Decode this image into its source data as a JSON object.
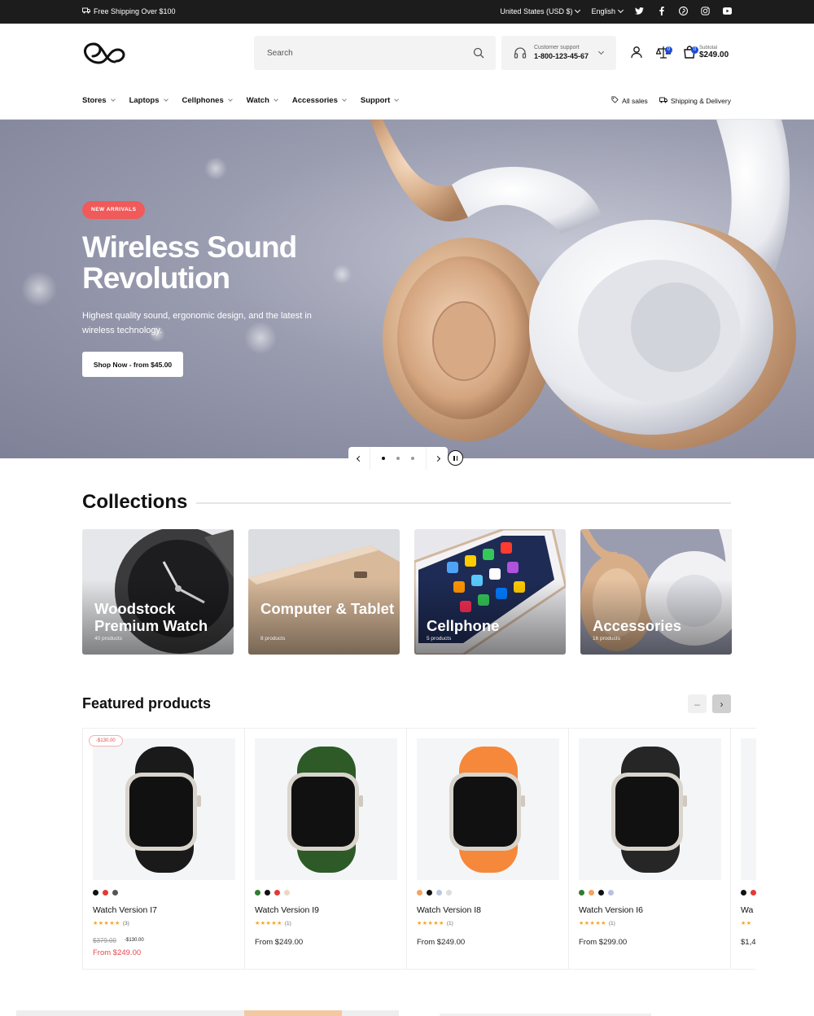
{
  "topbar": {
    "shipping": "Free Shipping Over $100",
    "country": "United States (USD $)",
    "language": "English",
    "socials": [
      "twitter-icon",
      "facebook-icon",
      "pinterest-icon",
      "instagram-icon",
      "youtube-icon"
    ]
  },
  "header": {
    "search_placeholder": "Search",
    "support_label": "Customer support",
    "support_phone": "1-800-123-45-67",
    "compare_count": "0",
    "cart_count": "0",
    "subtotal_label": "Subtotal",
    "subtotal_value": "$249.00"
  },
  "nav": {
    "items": [
      {
        "label": "Stores"
      },
      {
        "label": "Laptops"
      },
      {
        "label": "Cellphones"
      },
      {
        "label": "Watch"
      },
      {
        "label": "Accessories"
      },
      {
        "label": "Support"
      }
    ],
    "right": [
      {
        "label": "All sales",
        "icon": "tag-icon"
      },
      {
        "label": "Shipping & Delivery",
        "icon": "truck-icon"
      }
    ]
  },
  "hero": {
    "tag": "NEW ARRIVALS",
    "title": "Wireless Sound Revolution",
    "description": "Highest quality sound, ergonomic design, and the latest in wireless technology.",
    "cta": "Shop Now - from $45.00",
    "slides": 3,
    "active_slide": 1
  },
  "collections": {
    "title": "Collections",
    "items": [
      {
        "name": "Woodstock Premium Watch",
        "count": "40 products"
      },
      {
        "name": "Computer & Tablet",
        "count": "8 products"
      },
      {
        "name": "Cellphone",
        "count": "5 products"
      },
      {
        "name": "Accessories",
        "count": "16 products"
      }
    ]
  },
  "featured": {
    "title": "Featured products",
    "prev": "–",
    "next": "›",
    "products": [
      {
        "badge": "-$130.00",
        "name": "Watch Version I7",
        "stars": "★★★★★",
        "reviews": "(3)",
        "old_price": "$379.00",
        "discount": "-$130.00",
        "price": "From $249.00",
        "swatches": [
          "#111111",
          "#e53935",
          "#555555"
        ],
        "band": "#1a1a1a"
      },
      {
        "name": "Watch Version I9",
        "stars": "★★★★★",
        "reviews": "(1)",
        "price": "From $249.00",
        "swatches": [
          "#2e7d32",
          "#111111",
          "#e53935",
          "#e8d8c8"
        ],
        "band": "#2d5a27"
      },
      {
        "name": "Watch Version I8",
        "stars": "★★★★★",
        "reviews": "(1)",
        "price": "From $249.00",
        "swatches": [
          "#f4a261",
          "#111111",
          "#b9c7e0",
          "#dddddd"
        ],
        "band": "#f5883a"
      },
      {
        "name": "Watch Version I6",
        "stars": "★★★★★",
        "reviews": "(1)",
        "price": "From $299.00",
        "swatches": [
          "#2e7d32",
          "#f4a261",
          "#111111",
          "#b9c0e0"
        ],
        "band": "#262626"
      },
      {
        "name": "Wa",
        "stars": "★★",
        "reviews": "",
        "price": "$1,4",
        "swatches": [
          "#111111",
          "#e53935"
        ],
        "band": "#cccccc"
      }
    ]
  }
}
